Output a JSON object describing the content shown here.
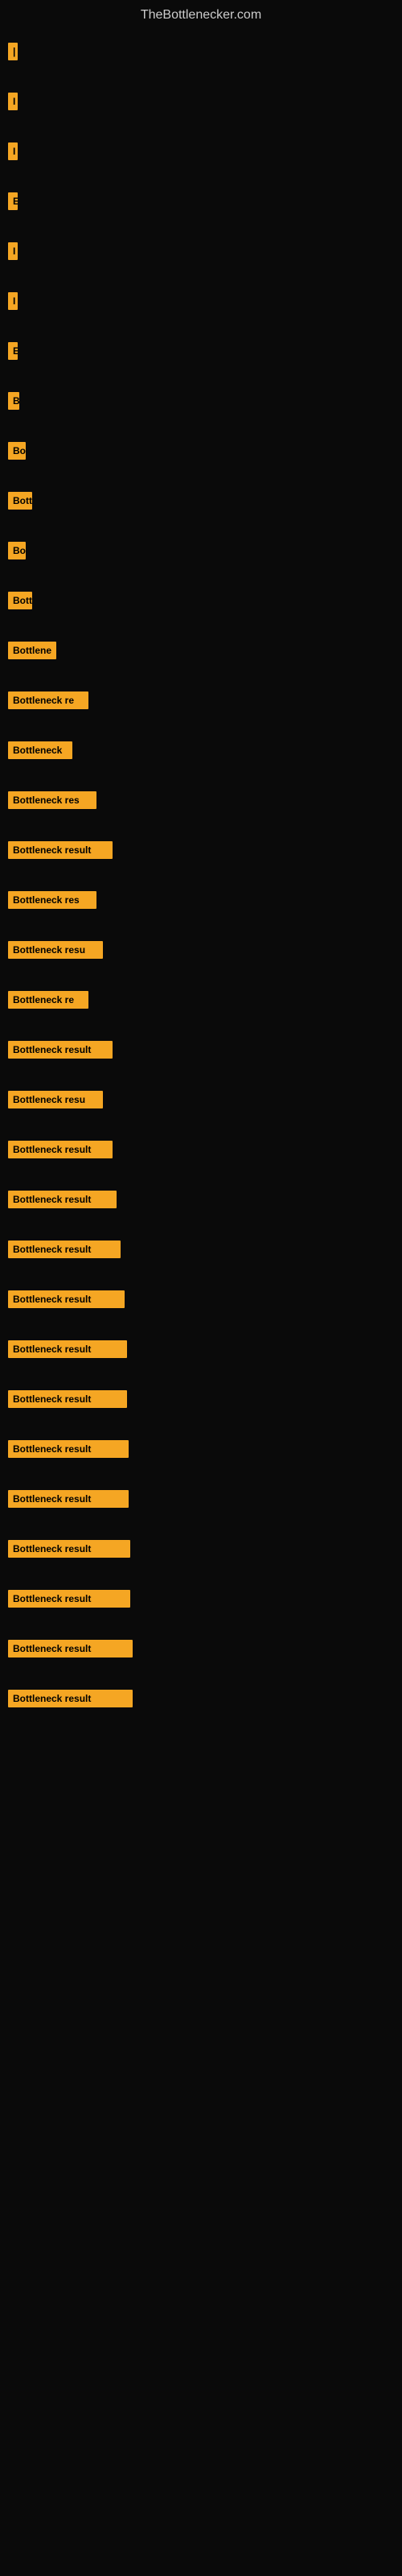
{
  "site_title": "TheBottlenecker.com",
  "rows": [
    {
      "label": "|",
      "width": 8
    },
    {
      "label": "",
      "width": 4,
      "spacer": true
    },
    {
      "label": "I",
      "width": 10
    },
    {
      "label": "",
      "width": 4,
      "spacer": true
    },
    {
      "label": "I",
      "width": 10
    },
    {
      "label": "",
      "width": 4,
      "spacer": true
    },
    {
      "label": "E",
      "width": 12
    },
    {
      "label": "",
      "width": 4,
      "spacer": true
    },
    {
      "label": "I",
      "width": 10
    },
    {
      "label": "",
      "width": 4,
      "spacer": true
    },
    {
      "label": "I",
      "width": 10
    },
    {
      "label": "",
      "width": 4,
      "spacer": true
    },
    {
      "label": "E",
      "width": 12
    },
    {
      "label": "",
      "width": 4,
      "spacer": true
    },
    {
      "label": "B",
      "width": 14
    },
    {
      "label": "",
      "width": 4,
      "spacer": true
    },
    {
      "label": "Bo",
      "width": 22
    },
    {
      "label": "",
      "width": 4,
      "spacer": true
    },
    {
      "label": "Bott",
      "width": 30
    },
    {
      "label": "",
      "width": 4,
      "spacer": true
    },
    {
      "label": "Bo",
      "width": 22
    },
    {
      "label": "",
      "width": 4,
      "spacer": true
    },
    {
      "label": "Bott",
      "width": 30
    },
    {
      "label": "",
      "width": 4,
      "spacer": true
    },
    {
      "label": "Bottlene",
      "width": 60
    },
    {
      "label": "",
      "width": 4,
      "spacer": true
    },
    {
      "label": "Bottleneck re",
      "width": 100
    },
    {
      "label": "",
      "width": 4,
      "spacer": true
    },
    {
      "label": "Bottleneck",
      "width": 80
    },
    {
      "label": "",
      "width": 4,
      "spacer": true
    },
    {
      "label": "Bottleneck res",
      "width": 110
    },
    {
      "label": "",
      "width": 4,
      "spacer": true
    },
    {
      "label": "Bottleneck result",
      "width": 130
    },
    {
      "label": "",
      "width": 4,
      "spacer": true
    },
    {
      "label": "Bottleneck res",
      "width": 110
    },
    {
      "label": "",
      "width": 4,
      "spacer": true
    },
    {
      "label": "Bottleneck resu",
      "width": 118
    },
    {
      "label": "",
      "width": 4,
      "spacer": true
    },
    {
      "label": "Bottleneck re",
      "width": 100
    },
    {
      "label": "",
      "width": 4,
      "spacer": true
    },
    {
      "label": "Bottleneck result",
      "width": 130
    },
    {
      "label": "",
      "width": 4,
      "spacer": true
    },
    {
      "label": "Bottleneck resu",
      "width": 118
    },
    {
      "label": "",
      "width": 4,
      "spacer": true
    },
    {
      "label": "Bottleneck result",
      "width": 130
    },
    {
      "label": "",
      "width": 4,
      "spacer": true
    },
    {
      "label": "Bottleneck result",
      "width": 135
    },
    {
      "label": "",
      "width": 4,
      "spacer": true
    },
    {
      "label": "Bottleneck result",
      "width": 140
    },
    {
      "label": "",
      "width": 4,
      "spacer": true
    },
    {
      "label": "Bottleneck result",
      "width": 145
    },
    {
      "label": "",
      "width": 4,
      "spacer": true
    },
    {
      "label": "Bottleneck result",
      "width": 148
    },
    {
      "label": "",
      "width": 4,
      "spacer": true
    },
    {
      "label": "Bottleneck result",
      "width": 148
    },
    {
      "label": "",
      "width": 4,
      "spacer": true
    },
    {
      "label": "Bottleneck result",
      "width": 150
    },
    {
      "label": "",
      "width": 4,
      "spacer": true
    },
    {
      "label": "Bottleneck result",
      "width": 150
    },
    {
      "label": "",
      "width": 4,
      "spacer": true
    },
    {
      "label": "Bottleneck result",
      "width": 152
    },
    {
      "label": "",
      "width": 4,
      "spacer": true
    },
    {
      "label": "Bottleneck result",
      "width": 152
    },
    {
      "label": "",
      "width": 4,
      "spacer": true
    },
    {
      "label": "Bottleneck result",
      "width": 155
    },
    {
      "label": "",
      "width": 4,
      "spacer": true
    },
    {
      "label": "Bottleneck result",
      "width": 155
    }
  ]
}
